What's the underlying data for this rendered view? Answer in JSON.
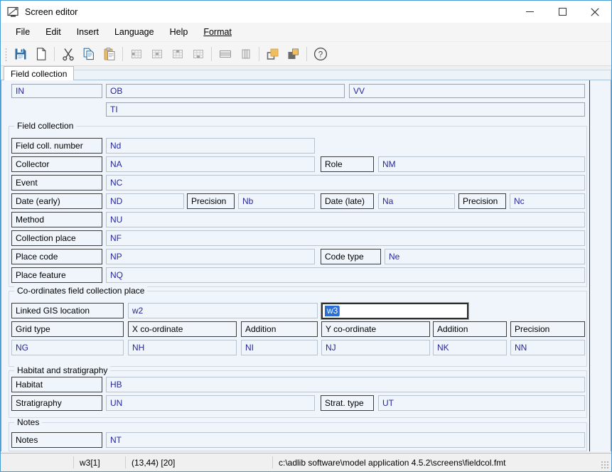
{
  "window": {
    "title": "Screen editor",
    "icon": "screen-editor-icon",
    "controls": {
      "minimize": "─",
      "maximize": "□",
      "close": "✕"
    }
  },
  "menu": {
    "items": [
      {
        "label": "File",
        "accel": ""
      },
      {
        "label": "Edit",
        "accel": ""
      },
      {
        "label": "Insert",
        "accel": ""
      },
      {
        "label": "Language",
        "accel": ""
      },
      {
        "label": "Help",
        "accel": ""
      },
      {
        "label": "Format",
        "accel": "F"
      }
    ]
  },
  "toolbar": {
    "buttons": [
      {
        "name": "save-icon",
        "tip": "Save"
      },
      {
        "name": "new-document-icon",
        "tip": "New"
      },
      {
        "name": "cut-scissors-icon",
        "tip": "Cut"
      },
      {
        "name": "copy-icon",
        "tip": "Copy"
      },
      {
        "name": "paste-clipboard-icon",
        "tip": "Paste"
      },
      {
        "name": "insert-cell-left-icon",
        "tip": "Insert cell"
      },
      {
        "name": "insert-row-icon",
        "tip": "Insert row"
      },
      {
        "name": "insert-cell-right-icon",
        "tip": "Delete cell"
      },
      {
        "name": "delete-row-icon",
        "tip": "Delete row"
      },
      {
        "name": "merge-rows-icon",
        "tip": "Merge rows"
      },
      {
        "name": "merge-columns-icon",
        "tip": "Merge columns"
      },
      {
        "name": "bring-to-front-icon",
        "tip": "Bring to front"
      },
      {
        "name": "send-to-back-icon",
        "tip": "Send to back"
      },
      {
        "name": "help-question-icon",
        "tip": "Help"
      }
    ]
  },
  "tabs": [
    {
      "label": "Field collection",
      "active": true
    }
  ],
  "canvas": {
    "top_row": [
      {
        "text": "IN",
        "kind": "tag"
      },
      {
        "text": "OB",
        "kind": "tag"
      },
      {
        "text": "VV",
        "kind": "tag"
      },
      {
        "text": "TI",
        "kind": "tag"
      }
    ],
    "groups": [
      {
        "title": "Field collection"
      },
      {
        "title": "Co-ordinates field collection place"
      },
      {
        "title": "Habitat and stratigraphy"
      },
      {
        "title": "Notes"
      }
    ],
    "field_collection": [
      {
        "label": "Field coll. number",
        "tag": "Nd"
      },
      {
        "label": "Collector",
        "tag": "NA",
        "label2": "Role",
        "tag2": "NM"
      },
      {
        "label": "Event",
        "tag": "NC"
      },
      {
        "label": "Date (early)",
        "tag": "ND",
        "label2": "Precision",
        "tag2": "Nb",
        "label3": "Date (late)",
        "tag3": "Na",
        "label4": "Precision",
        "tag4": "Nc"
      },
      {
        "label": "Method",
        "tag": "NU"
      },
      {
        "label": "Collection place",
        "tag": "NF"
      },
      {
        "label": "Place code",
        "tag": "NP",
        "label2": "Code type",
        "tag2": "Ne"
      },
      {
        "label": "Place feature",
        "tag": "NQ"
      }
    ],
    "coordinates": {
      "gis_label": "Linked GIS location",
      "gis_tag": "w2",
      "selected_tag": "w3",
      "headers": [
        "Grid type",
        "X co-ordinate",
        "Addition",
        "Y co-ordinate",
        "Addition",
        "Precision"
      ],
      "tags": [
        "NG",
        "NH",
        "NI",
        "NJ",
        "NK",
        "NN"
      ]
    },
    "habitat": [
      {
        "label": "Habitat",
        "tag": "HB"
      },
      {
        "label": "Stratigraphy",
        "tag": "UN",
        "label2": "Strat. type",
        "tag2": "UT"
      }
    ],
    "notes": [
      {
        "label": "Notes",
        "tag": "NT"
      }
    ]
  },
  "statusbar": {
    "field": "w3[1]",
    "position": "(13,44) [20]",
    "path": "c:\\adlib software\\model application 4.5.2\\screens\\fieldcol.fmt"
  },
  "colors": {
    "canvas_bg": "#eff5fb",
    "tag_text": "#26269c",
    "selection_bg": "#2a6fd1",
    "screen_line": "#2b2b9c",
    "window_border": "#4a9bd1"
  }
}
